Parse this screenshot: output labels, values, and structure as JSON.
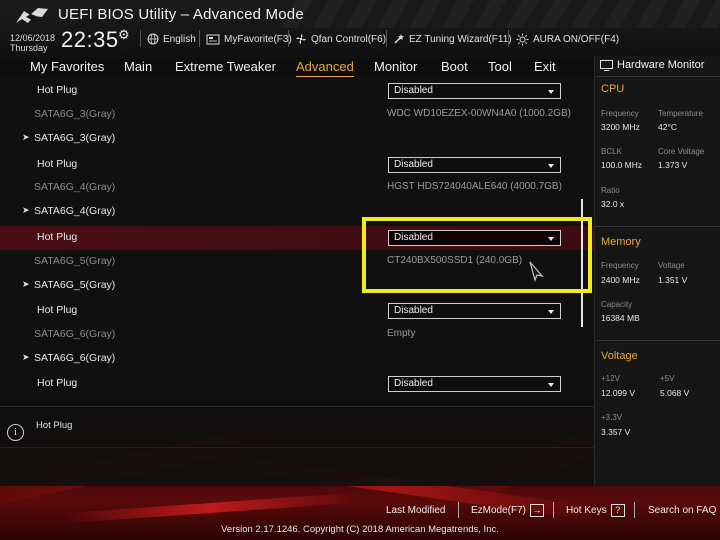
{
  "header": {
    "title": "UEFI BIOS Utility – Advanced Mode",
    "date": "12/06/2018",
    "day": "Thursday",
    "time": "22:35",
    "items": [
      {
        "label": "English",
        "icon": "globe-icon"
      },
      {
        "label": "MyFavorite(F3)",
        "icon": "favorite-icon"
      },
      {
        "label": "Qfan Control(F6)",
        "icon": "fan-icon"
      },
      {
        "label": "EZ Tuning Wizard(F11)",
        "icon": "wizard-icon"
      },
      {
        "label": "AURA ON/OFF(F4)",
        "icon": "aura-icon"
      }
    ]
  },
  "tabs": [
    "My Favorites",
    "Main",
    "Extreme Tweaker",
    "Advanced",
    "Monitor",
    "Boot",
    "Tool",
    "Exit"
  ],
  "active_tab": "Advanced",
  "rows": [
    {
      "label": "Hot Plug",
      "value": "Disabled",
      "kind": "dropdown"
    },
    {
      "label": "SATA6G_3(Gray)",
      "value": "WDC WD10EZEX-00WN4A0 (1000.2GB)",
      "kind": "info"
    },
    {
      "label": "SATA6G_3(Gray)",
      "kind": "group"
    },
    {
      "label": "Hot Plug",
      "value": "Disabled",
      "kind": "dropdown"
    },
    {
      "label": "SATA6G_4(Gray)",
      "value": "HGST HDS724040ALE640 (4000.7GB)",
      "kind": "info"
    },
    {
      "label": "SATA6G_4(Gray)",
      "kind": "group"
    },
    {
      "label": "Hot Plug",
      "value": "Disabled",
      "kind": "dropdown",
      "selected": true
    },
    {
      "label": "SATA6G_5(Gray)",
      "value": "CT240BX500SSD1 (240.0GB)",
      "kind": "info"
    },
    {
      "label": "SATA6G_5(Gray)",
      "kind": "group"
    },
    {
      "label": "Hot Plug",
      "value": "Disabled",
      "kind": "dropdown"
    },
    {
      "label": "SATA6G_6(Gray)",
      "value": "Empty",
      "kind": "info"
    },
    {
      "label": "SATA6G_6(Gray)",
      "kind": "group"
    },
    {
      "label": "Hot Plug",
      "value": "Disabled",
      "kind": "dropdown"
    }
  ],
  "help": {
    "text": "Hot Plug"
  },
  "hardware_monitor": {
    "title": "Hardware Monitor",
    "cpu": {
      "title": "CPU",
      "frequency_label": "Frequency",
      "frequency": "3200 MHz",
      "temperature_label": "Temperature",
      "temperature": "42°C",
      "bclk_label": "BCLK",
      "bclk": "100.0 MHz",
      "core_voltage_label": "Core Voltage",
      "core_voltage": "1.373 V",
      "ratio_label": "Ratio",
      "ratio": "32.0 x"
    },
    "memory": {
      "title": "Memory",
      "frequency_label": "Frequency",
      "frequency": "2400 MHz",
      "voltage_label": "Voltage",
      "voltage": "1.351 V",
      "capacity_label": "Capacity",
      "capacity": "16384 MB"
    },
    "voltage": {
      "title": "Voltage",
      "v12_label": "+12V",
      "v12": "12.099 V",
      "v5_label": "+5V",
      "v5": "5.068 V",
      "v33_label": "+3.3V",
      "v33": "3.357 V"
    }
  },
  "footer": {
    "last_modified": "Last Modified",
    "ezmode": "EzMode(F7)",
    "ezmode_icon": "→",
    "hot_keys": "Hot Keys",
    "hot_keys_icon": "?",
    "search": "Search on FAQ",
    "version": "Version 2.17.1246. Copyright (C) 2018 American Megatrends, Inc."
  },
  "colors": {
    "accent": "#e8a83e",
    "highlight": "#f2ec1a",
    "selected_row": "#4a0f14"
  }
}
